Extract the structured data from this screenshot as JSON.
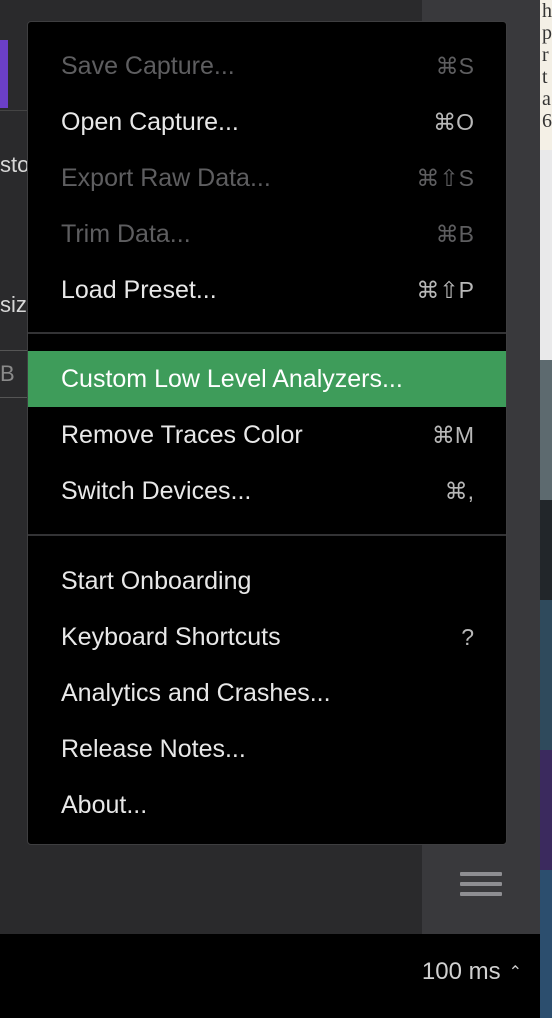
{
  "background": {
    "left_fragments": [
      "sto",
      "siz",
      "B"
    ],
    "right_doc_fragments": [
      "h",
      "p",
      "r",
      "t",
      "a",
      "6"
    ]
  },
  "menu": {
    "sections": [
      [
        {
          "label": "Save Capture...",
          "shortcut": "⌘S",
          "disabled": true
        },
        {
          "label": "Open Capture...",
          "shortcut": "⌘O",
          "disabled": false
        },
        {
          "label": "Export Raw Data...",
          "shortcut": "⌘⇧S",
          "disabled": true
        },
        {
          "label": "Trim Data...",
          "shortcut": "⌘B",
          "disabled": true
        },
        {
          "label": "Load Preset...",
          "shortcut": "⌘⇧P",
          "disabled": false
        }
      ],
      [
        {
          "label": "Custom Low Level Analyzers...",
          "shortcut": "",
          "active": true
        },
        {
          "label": "Remove Traces Color",
          "shortcut": "⌘M"
        },
        {
          "label": "Switch Devices...",
          "shortcut": "⌘,"
        }
      ],
      [
        {
          "label": "Start Onboarding",
          "shortcut": ""
        },
        {
          "label": "Keyboard Shortcuts",
          "shortcut": "?"
        },
        {
          "label": "Analytics and Crashes...",
          "shortcut": ""
        },
        {
          "label": "Release Notes...",
          "shortcut": ""
        },
        {
          "label": "About...",
          "shortcut": ""
        }
      ]
    ]
  },
  "status_bar": {
    "zoom_label": "100 ms",
    "zoom_caret": "⌃"
  },
  "colors": {
    "highlight": "#3e9c5a",
    "menu_bg": "#000000",
    "accent_purple": "#6b3fc7"
  }
}
